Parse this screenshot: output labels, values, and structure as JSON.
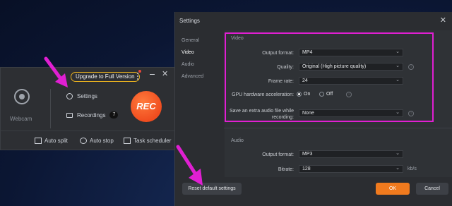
{
  "recorder": {
    "upgrade_label": "Upgrade to Full Version",
    "webcam_label": "Webcam",
    "settings_label": "Settings",
    "recordings_label": "Recordings",
    "recordings_count": "7",
    "rec_label": "REC",
    "tools": {
      "auto_split": "Auto split",
      "auto_stop": "Auto stop",
      "task_scheduler": "Task scheduler"
    }
  },
  "settings": {
    "title": "Settings",
    "nav": [
      "General",
      "Video",
      "Audio",
      "Advanced"
    ],
    "active_nav": "Video",
    "video": {
      "section": "Video",
      "output_format_label": "Output format:",
      "output_format_value": "MP4",
      "quality_label": "Quality:",
      "quality_value": "Original (High picture quality)",
      "frame_rate_label": "Frame rate:",
      "frame_rate_value": "24",
      "gpu_label": "GPU hardware acceleration:",
      "gpu_on": "On",
      "gpu_off": "Off",
      "save_audio_label": "Save an extra audio file while recording:",
      "save_audio_value": "None"
    },
    "audio": {
      "section": "Audio",
      "output_format_label": "Output format:",
      "output_format_value": "MP3",
      "bitrate_label": "Bitrate:",
      "bitrate_value": "128",
      "bitrate_unit": "kb/s"
    },
    "buttons": {
      "reset": "Reset default settings",
      "ok": "OK",
      "cancel": "Cancel"
    }
  },
  "colors": {
    "accent": "#f07a1e",
    "rec": "#f04d1f",
    "highlight": "#e01fd2"
  }
}
